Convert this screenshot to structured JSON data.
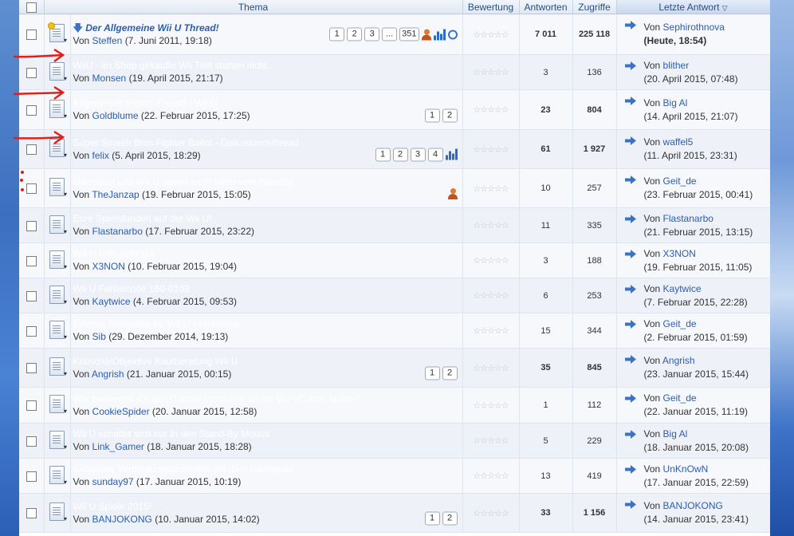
{
  "header": {
    "thema": "Thema",
    "bewertung": "Bewertung",
    "antworten": "Antworten",
    "zugriffe": "Zugriffe",
    "letzte_antwort": "Letzte Antwort"
  },
  "rows": [
    {
      "title": "Der Allgemeine Wii U Thread!",
      "by": "Von ",
      "author": "Steffen",
      "date": "(7. Juni 2011, 19:18)",
      "pages": [
        "1",
        "2",
        "3",
        "...",
        "351"
      ],
      "answers": "7 011",
      "views": "225 118",
      "last_prefix": "Von ",
      "last_user": "Sephirothnova",
      "last_date": "(Heute, 18:54)"
    },
    {
      "title": "WiiU - im Shop gekaufte Wii Titel starten nicht.",
      "by": "Von ",
      "author": "Monsen",
      "date": "(19. April 2015, 21:17)",
      "pages": [],
      "answers": "3",
      "views": "136",
      "last_prefix": "Von ",
      "last_user": "blither",
      "last_date": "(20. April 2015, 07:48)"
    },
    {
      "title": "Allgemeiner Fehler Thread - Wii U",
      "by": "Von ",
      "author": "Goldblume",
      "date": "(22. Februar 2015, 17:25)",
      "pages": [
        "1",
        "2"
      ],
      "answers": "23",
      "views": "804",
      "last_prefix": "Von ",
      "last_user": "Big Al",
      "last_date": "(14. April 2015, 21:07)"
    },
    {
      "title": "Super Smash Bros Fighter Ballot - Diskussionsthread",
      "by": "Von ",
      "author": "felix",
      "date": "(5. April 2015, 18:29)",
      "pages": [
        "1",
        "2",
        "3",
        "4"
      ],
      "answers": "61",
      "views": "1 927",
      "last_prefix": "Von ",
      "last_user": "waffel5",
      "last_date": "(11. April 2015, 23:31)"
    },
    {
      "title": "Gamepad und Wii U startet nicht mehr vom Standby",
      "by": "Von ",
      "author": "TheJanzap",
      "date": "(19. Februar 2015, 15:05)",
      "pages": [],
      "answers": "10",
      "views": "257",
      "last_prefix": "Von ",
      "last_user": "Geit_de",
      "last_date": "(23. Februar 2015, 00:41)"
    },
    {
      "title": "Eure Spielstunden auf der Wii U!",
      "by": "Von ",
      "author": "Flastanarbo",
      "date": "(17. Februar 2015, 23:22)",
      "pages": [],
      "answers": "11",
      "views": "335",
      "last_prefix": "Von ",
      "last_user": "Flastanarbo",
      "last_date": "(21. Februar 2015, 13:15)"
    },
    {
      "title": "Wii U Hilfe sehr gut",
      "by": "Von ",
      "author": "X3NON",
      "date": "(10. Februar 2015, 19:04)",
      "pages": [],
      "answers": "3",
      "views": "188",
      "last_prefix": "Von ",
      "last_user": "X3NON",
      "last_date": "(19. Februar 2015, 11:05)"
    },
    {
      "title": "Wii U Fehlercode 160-0103",
      "by": "Von ",
      "author": "Kaytwice",
      "date": "(4. Februar 2015, 09:53)",
      "pages": [],
      "answers": "6",
      "views": "253",
      "last_prefix": "Von ",
      "last_user": "Kaytwice",
      "last_date": "(7. Februar 2015, 22:28)"
    },
    {
      "title": "Externe Festplatte für Wii U - Probleme",
      "by": "Von ",
      "author": "Sib",
      "date": "(29. Dezember 2014, 19:13)",
      "pages": [],
      "answers": "15",
      "views": "344",
      "last_prefix": "Von ",
      "last_user": "Geit_de",
      "last_date": "(2. Februar 2015, 01:59)"
    },
    {
      "title": "Kritische/Objektive Kaufberatung Wii U",
      "by": "Von ",
      "author": "Angrish",
      "date": "(21. Januar 2015, 00:15)",
      "pages": [
        "1",
        "2"
      ],
      "answers": "35",
      "views": "845",
      "last_prefix": "Von ",
      "last_user": "Angrish",
      "last_date": "(23. Januar 2015, 15:44)"
    },
    {
      "title": "Wie bekomme ich den Classic Controller an die Wii VC zum laufen?",
      "by": "Von ",
      "author": "CookieSpider",
      "date": "(20. Januar 2015, 12:58)",
      "pages": [],
      "answers": "1",
      "views": "112",
      "last_prefix": "Von ",
      "last_user": "Geit_de",
      "last_date": "(22. Januar 2015, 11:19)"
    },
    {
      "title": "Wii U schaltet sich nur in den Stand-By Modus",
      "by": "Von ",
      "author": "Link_Gamer",
      "date": "(18. Januar 2015, 18:28)",
      "pages": [],
      "answers": "5",
      "views": "229",
      "last_prefix": "Von ",
      "last_user": "Big Al",
      "last_date": "(18. Januar 2015, 20:08)"
    },
    {
      "title": "Kabellose Verbindungsprobleme mit dem Gamepad",
      "by": "Von ",
      "author": "sunday97",
      "date": "(17. Januar 2015, 10:19)",
      "pages": [],
      "answers": "13",
      "views": "419",
      "last_prefix": "Von ",
      "last_user": "UnKnOwN",
      "last_date": "(17. Januar 2015, 22:59)"
    },
    {
      "title": "Wii U Spiele 2015!",
      "by": "Von ",
      "author": "BANJOKONG",
      "date": "(10. Januar 2015, 14:02)",
      "pages": [
        "1",
        "2"
      ],
      "answers": "33",
      "views": "1 156",
      "last_prefix": "Von ",
      "last_user": "BANJOKONG",
      "last_date": "(14. Januar 2015, 23:41)"
    }
  ]
}
